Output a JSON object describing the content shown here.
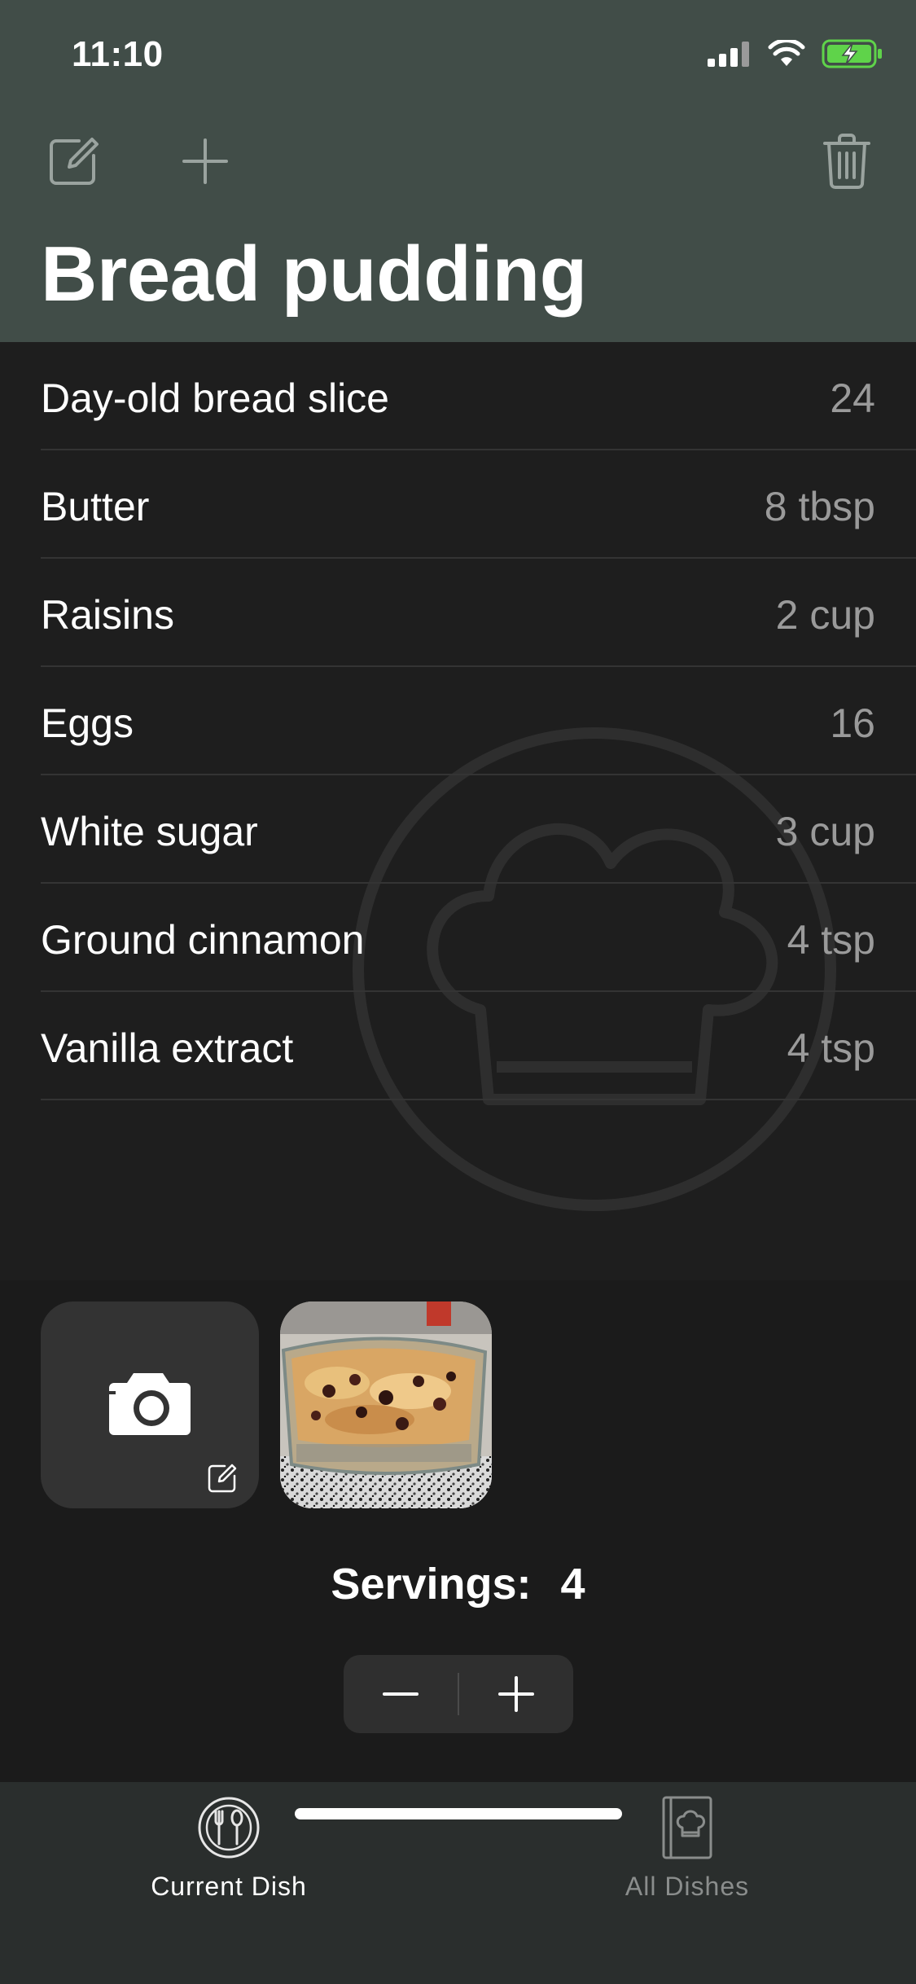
{
  "status_bar": {
    "time": "11:10"
  },
  "header": {
    "title": "Bread pudding"
  },
  "ingredients": [
    {
      "name": "Day-old bread slice",
      "quantity": "24"
    },
    {
      "name": "Butter",
      "quantity": "8 tbsp"
    },
    {
      "name": "Raisins",
      "quantity": "2 cup"
    },
    {
      "name": "Eggs",
      "quantity": "16"
    },
    {
      "name": "White sugar",
      "quantity": "3 cup"
    },
    {
      "name": "Ground cinnamon",
      "quantity": "4 tsp"
    },
    {
      "name": "Vanilla extract",
      "quantity": "4 tsp"
    }
  ],
  "servings": {
    "label": "Servings:",
    "value": "4"
  },
  "tabs": [
    {
      "label": "Current Dish",
      "icon": "fork-spoon-plate-icon",
      "active": true
    },
    {
      "label": "All Dishes",
      "icon": "recipe-book-icon",
      "active": false
    }
  ],
  "colors": {
    "header_bg": "#414d48",
    "list_bg": "#1e1e1e",
    "tabbar_bg": "#2a2e2d",
    "battery_green": "#5fd34a"
  }
}
